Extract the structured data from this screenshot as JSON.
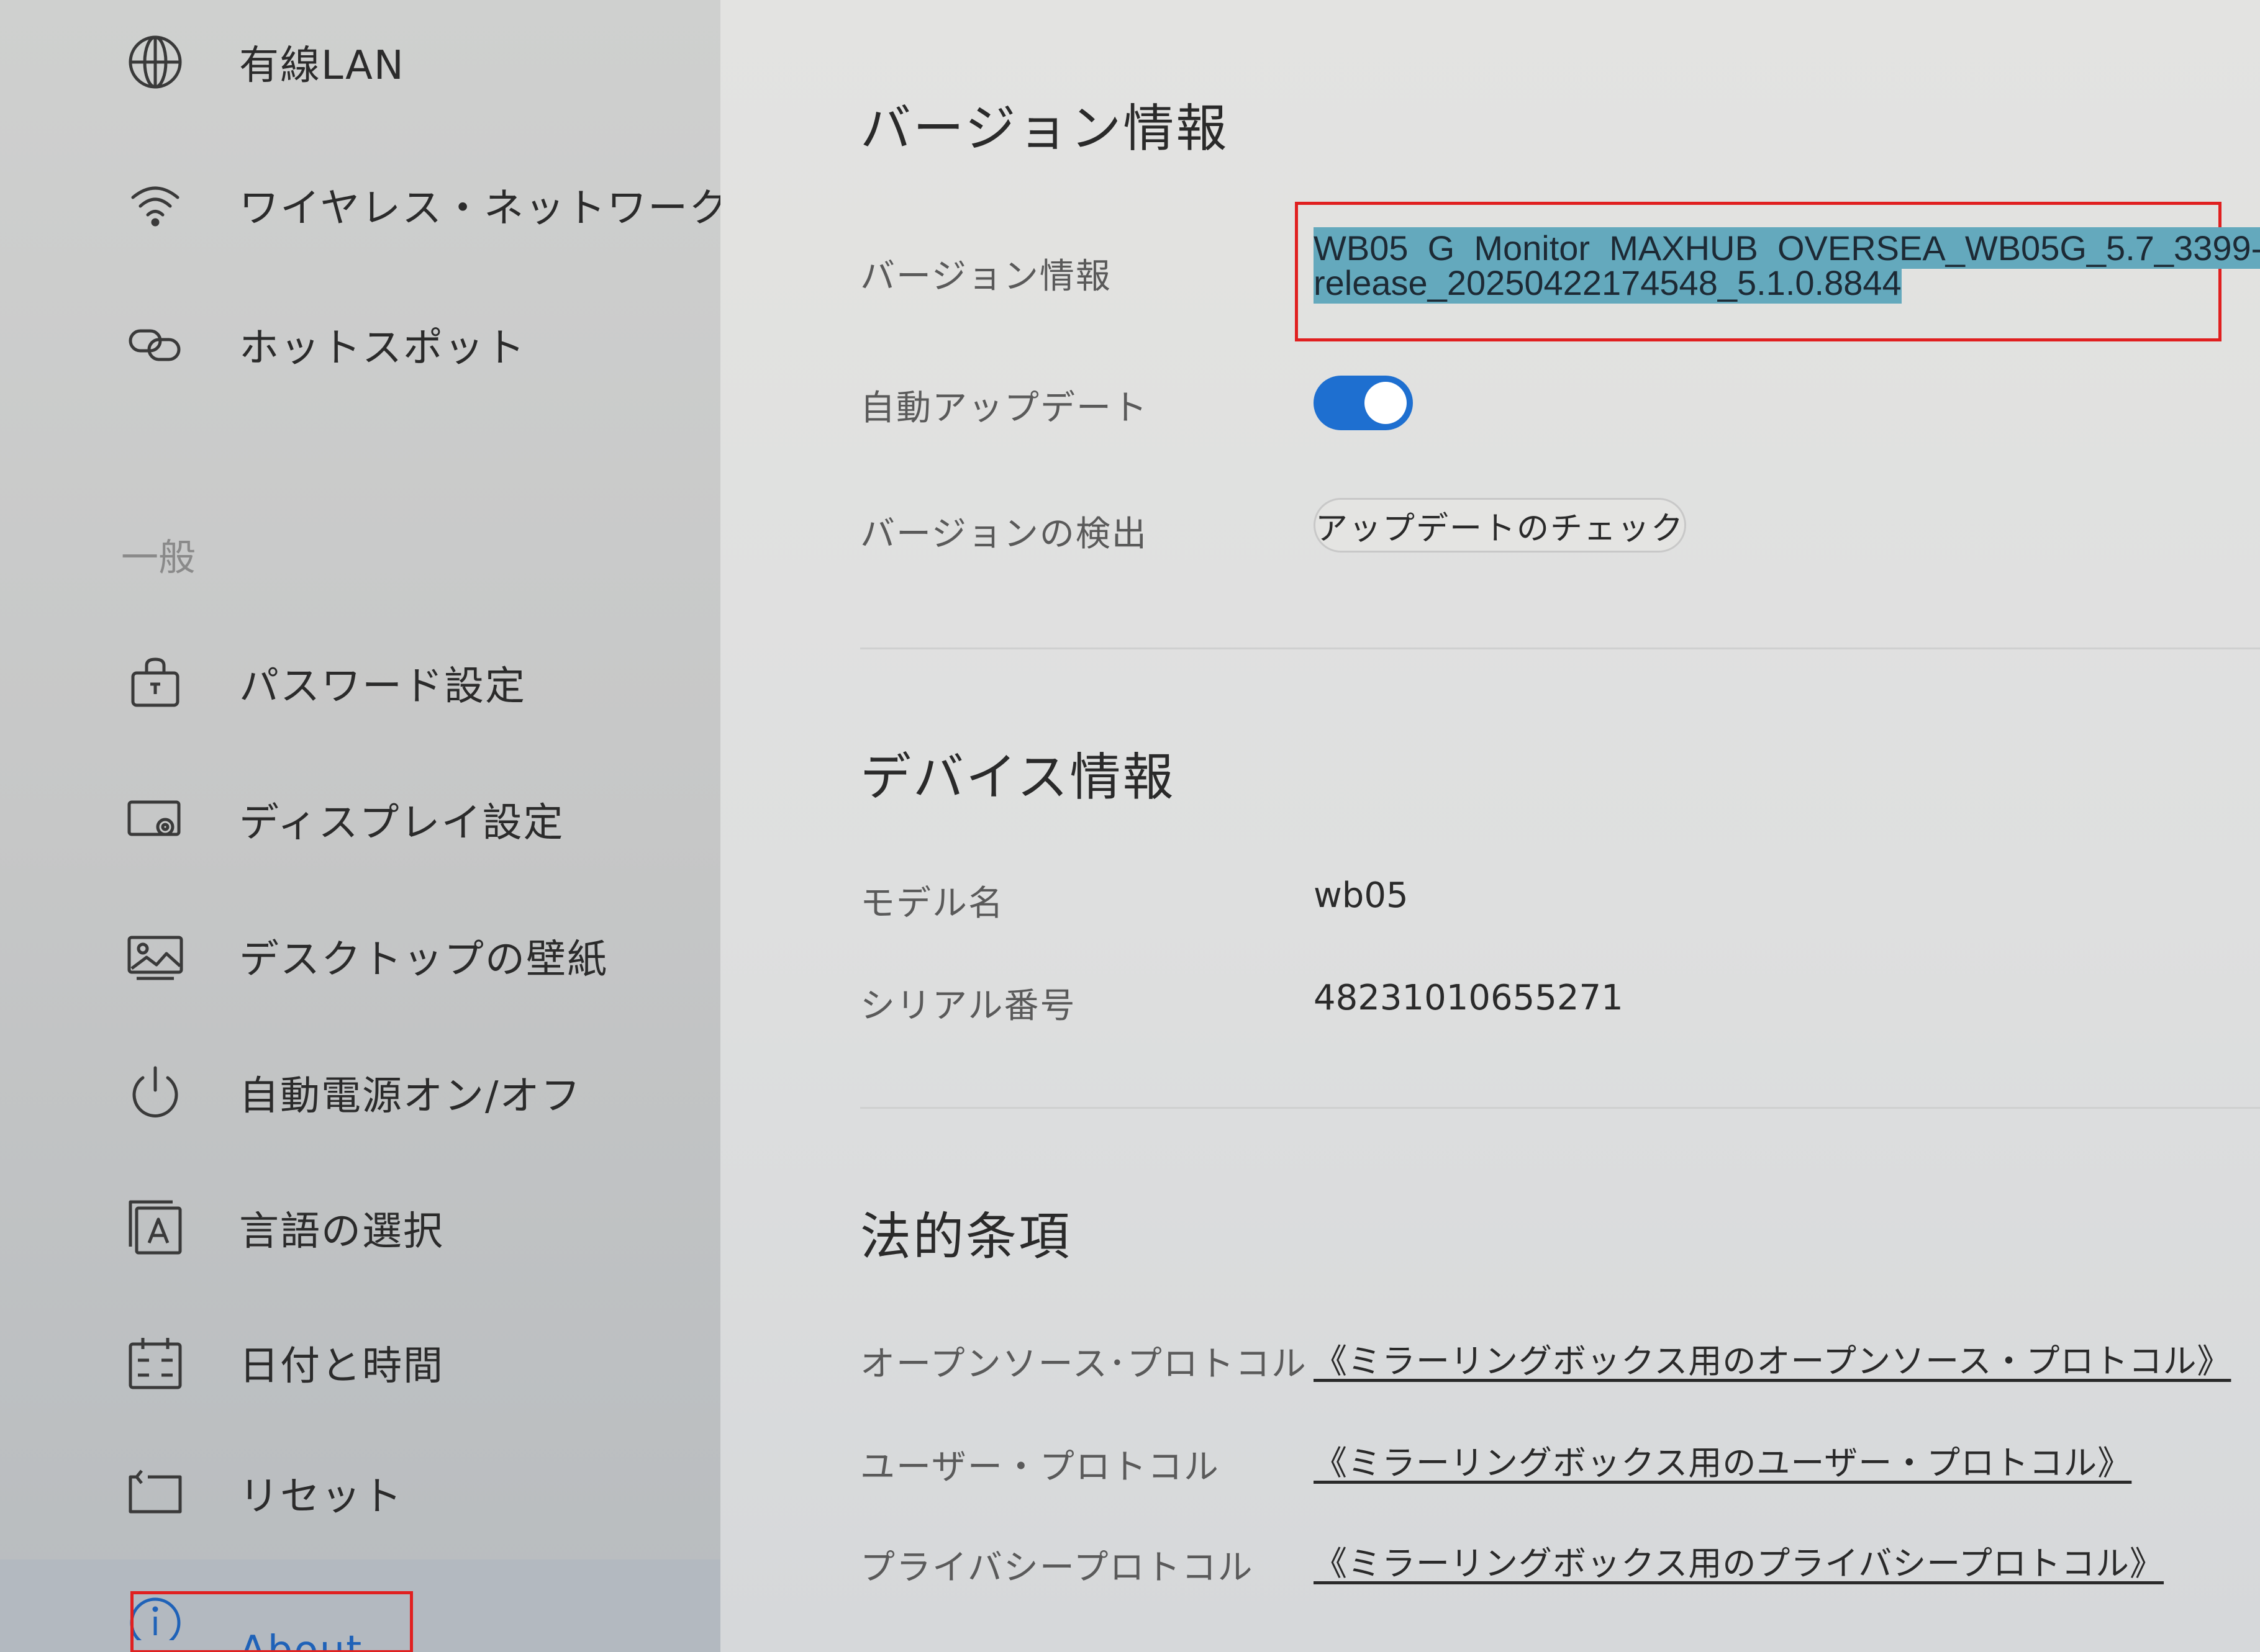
{
  "sidebar": {
    "network_items": [
      {
        "label": "有線LAN",
        "icon": "globe-icon"
      },
      {
        "label": "ワイヤレス・ネットワーク",
        "icon": "wifi-icon"
      },
      {
        "label": "ホットスポット",
        "icon": "hotspot-icon"
      }
    ],
    "section_general": "一般",
    "general_items": [
      {
        "label": "パスワード設定",
        "icon": "lock-icon"
      },
      {
        "label": "ディスプレイ設定",
        "icon": "display-settings-icon"
      },
      {
        "label": "デスクトップの壁紙",
        "icon": "wallpaper-icon"
      },
      {
        "label": "自動電源オン/オフ",
        "icon": "power-icon"
      },
      {
        "label": "言語の選択",
        "icon": "language-icon"
      },
      {
        "label": "日付と時間",
        "icon": "calendar-icon"
      },
      {
        "label": "リセット",
        "icon": "reset-icon"
      }
    ],
    "about": {
      "label": "About",
      "icon": "info-icon",
      "selected": true
    }
  },
  "version_section": {
    "title": "バージョン情報",
    "version_label": "バージョン情報",
    "version_line1": "WB05_G_Monitor_MAXHUB_OVERSEA_WB05G_5.7_3399-",
    "version_line2": "release_20250422174548_5.1.0.8844",
    "auto_update_label": "自動アップデート",
    "auto_update_enabled": true,
    "detect_label": "バージョンの検出",
    "check_button_label": "アップデートのチェック"
  },
  "device_section": {
    "title": "デバイス情報",
    "model_label": "モデル名",
    "model_value": "wb05",
    "serial_label": "シリアル番号",
    "serial_value": "48231010655271"
  },
  "legal_section": {
    "title": "法的条項",
    "open_source_label": "オープンソース･プロトコル",
    "open_source_link": "《ミラーリングボックス用のオープンソース・プロトコル》",
    "user_label": "ユーザー・プロトコル",
    "user_link": "《ミラーリングボックス用のユーザー・プロトコル》",
    "privacy_label": "プライバシープロトコル",
    "privacy_link": "《ミラーリングボックス用のプライバシープロトコル》"
  },
  "colors": {
    "accent": "#1e6fd0",
    "highlight": "#64a9bd",
    "annotation_box": "#e02020",
    "selected_row": "#b3b9c0"
  }
}
